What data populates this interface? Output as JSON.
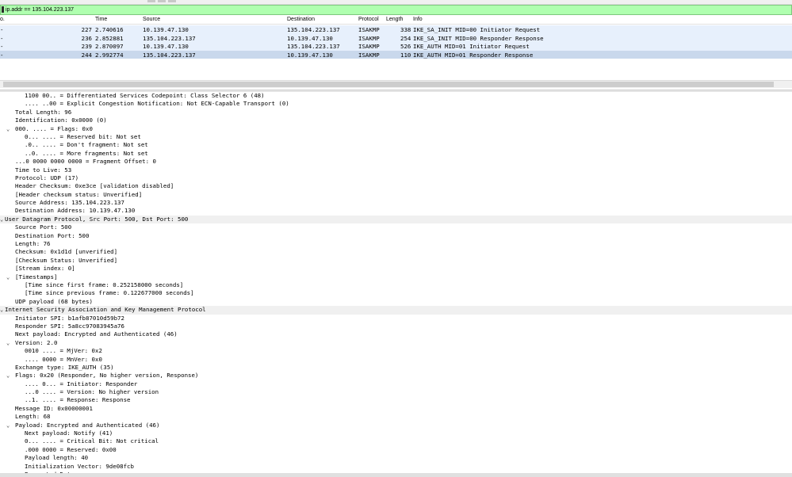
{
  "filter": {
    "value": "ip.addr == 135.104.223.137"
  },
  "packet_list": {
    "columns": {
      "no": "o.",
      "time": "Time",
      "source": "Source",
      "destination": "Destination",
      "protocol": "Protocol",
      "length": "Length",
      "info": "Info"
    },
    "rows": [
      {
        "marker": "-",
        "no": "227",
        "time": "2.740616",
        "source": "10.139.47.130",
        "destination": "135.104.223.137",
        "protocol": "ISAKMP",
        "length": "338",
        "info": "IKE_SA_INIT MID=00 Initiator Request"
      },
      {
        "marker": "-",
        "no": "236",
        "time": "2.852881",
        "source": "135.104.223.137",
        "destination": "10.139.47.130",
        "protocol": "ISAKMP",
        "length": "254",
        "info": "IKE_SA_INIT MID=00 Responder Response"
      },
      {
        "marker": "-",
        "no": "239",
        "time": "2.870097",
        "source": "10.139.47.130",
        "destination": "135.104.223.137",
        "protocol": "ISAKMP",
        "length": "526",
        "info": "IKE_AUTH MID=01 Initiator Request"
      },
      {
        "marker": "-",
        "no": "244",
        "time": "2.992774",
        "source": "135.104.223.137",
        "destination": "10.139.47.130",
        "protocol": "ISAKMP",
        "length": "110",
        "info": "IKE_AUTH MID=01 Responder Response"
      }
    ]
  },
  "details": {
    "lines": [
      "1100 00.. = Differentiated Services Codepoint: Class Selector 6 (48)",
      ".... ..00 = Explicit Congestion Notification: Not ECN-Capable Transport (0)",
      "Total Length: 96",
      "Identification: 0x0000 (0)",
      "000. .... = Flags: 0x0",
      "0... .... = Reserved bit: Not set",
      ".0.. .... = Don't fragment: Not set",
      "..0. .... = More fragments: Not set",
      "...0 0000 0000 0000 = Fragment Offset: 0",
      "Time to Live: 53",
      "Protocol: UDP (17)",
      "Header Checksum: 0xe3ce [validation disabled]",
      "[Header checksum status: Unverified]",
      "Source Address: 135.104.223.137",
      "Destination Address: 10.139.47.130",
      "User Datagram Protocol, Src Port: 500, Dst Port: 500",
      "Source Port: 500",
      "Destination Port: 500",
      "Length: 76",
      "Checksum: 0x1d1d [unverified]",
      "[Checksum Status: Unverified]",
      "[Stream index: 0]",
      "[Timestamps]",
      "[Time since first frame: 0.252158000 seconds]",
      "[Time since previous frame: 0.122677000 seconds]",
      "UDP payload (68 bytes)",
      "Internet Security Association and Key Management Protocol",
      "Initiator SPI: b1afb87010d59b72",
      "Responder SPI: 5a8cc97083945a76",
      "Next payload: Encrypted and Authenticated (46)",
      "Version: 2.0",
      "0010 .... = MjVer: 0x2",
      ".... 0000 = MnVer: 0x0",
      "Exchange type: IKE_AUTH (35)",
      "Flags: 0x20 (Responder, No higher version, Response)",
      ".... 0... = Initiator: Responder",
      "...0 .... = Version: No higher version",
      "..1. .... = Response: Response",
      "Message ID: 0x00000001",
      "Length: 68",
      "Payload: Encrypted and Authenticated (46)",
      "Next payload: Notify (41)",
      "0... .... = Critical Bit: Not critical",
      ".000 0000 = Reserved: 0x00",
      "Payload length: 40",
      "Initialization Vector: 9de08fcb",
      "Encrypted Data"
    ]
  }
}
